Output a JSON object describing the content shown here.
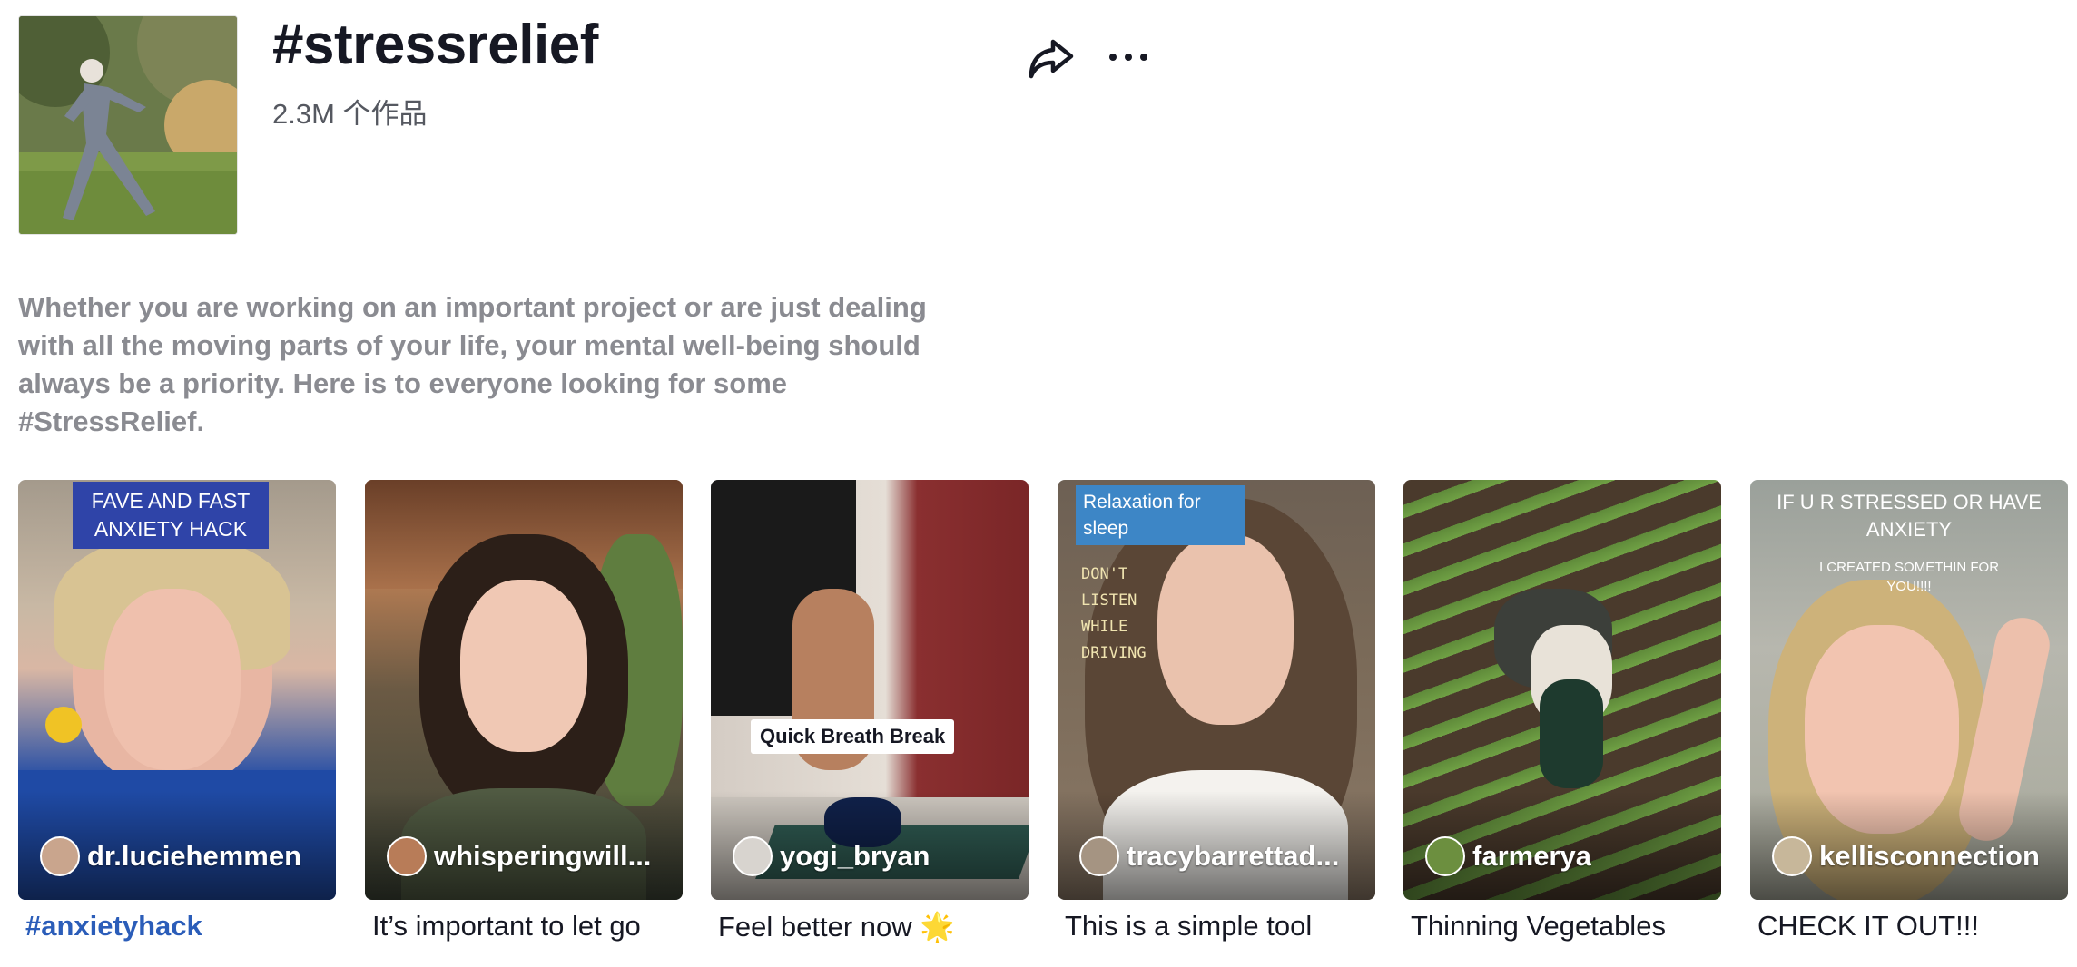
{
  "header": {
    "title": "#stressrelief",
    "count": "2.3M 个作品",
    "share_icon": "share-icon",
    "more_icon": "more-icon"
  },
  "description": "Whether you are working on an important project or are just dealing with all the moving parts of your life, your mental well-being should always be a priority. Here is to everyone looking for some #StressRelief.",
  "videos": [
    {
      "author": "dr.luciehemmen",
      "caption": "#anxietyhack",
      "overlay": "FAVE AND FAST ANXIETY HACK"
    },
    {
      "author": "whisperingwill...",
      "caption": "It’s important to let go"
    },
    {
      "author": "yogi_bryan",
      "caption": "Feel better now 🌟",
      "overlay": "Quick Breath Break"
    },
    {
      "author": "tracybarrettad...",
      "caption": "This is a simple tool",
      "overlay": "Relaxation for sleep",
      "overlay2": "DON'T LISTEN WHILE DRIVING"
    },
    {
      "author": "farmerya",
      "caption": "Thinning Vegetables"
    },
    {
      "author": "kellisconnection",
      "caption": "CHECK IT OUT!!!",
      "overlay": "IF U R STRESSED OR HAVE ANXIETY",
      "overlay2": "I CREATED SOMETHIN FOR YOU!!!!"
    }
  ],
  "colors": {
    "hashtag_caption": "#2b5db9",
    "description": "#8a8b91",
    "overlay_blue": "#2f44a8",
    "overlay_light_blue": "#3d86c6"
  }
}
